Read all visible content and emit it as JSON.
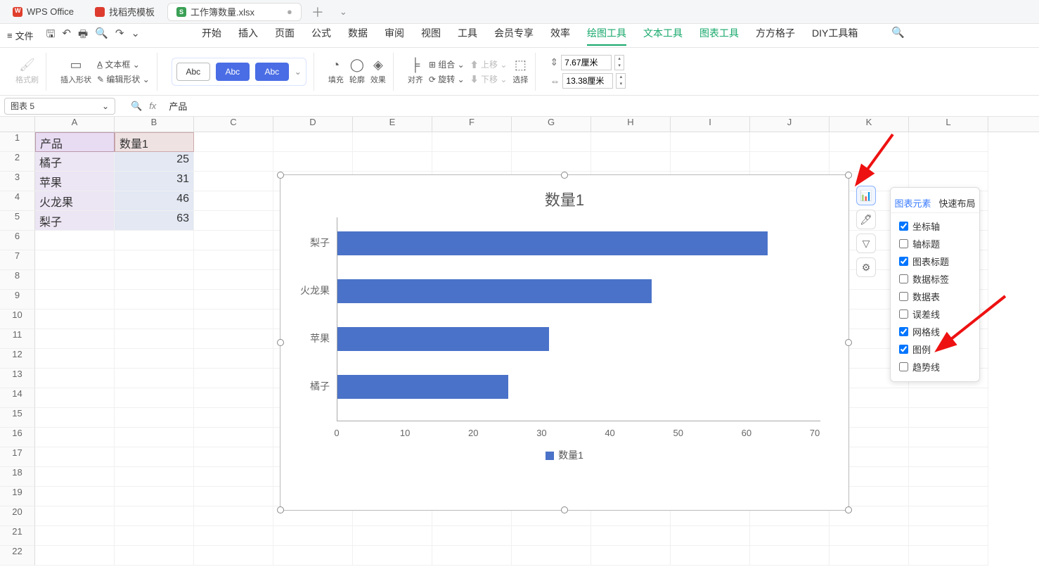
{
  "tabs": {
    "app": "WPS Office",
    "template": "找稻壳模板",
    "file": "工作簿数量.xlsx"
  },
  "menu": {
    "file": "文件",
    "items": [
      "开始",
      "插入",
      "页面",
      "公式",
      "数据",
      "审阅",
      "视图",
      "工具",
      "会员专享",
      "效率"
    ],
    "tools": [
      "绘图工具",
      "文本工具",
      "图表工具",
      "方方格子",
      "DIY工具箱"
    ]
  },
  "ribbon": {
    "fmt": "格式刷",
    "ins": "插入形状",
    "txt": "文本框",
    "edit": "编辑形状",
    "abc": "Abc",
    "fill": "填充",
    "outline": "轮廓",
    "effect": "效果",
    "align": "对齐",
    "group": "组合",
    "rotate": "旋转",
    "up": "上移",
    "down": "下移",
    "select": "选择",
    "h": "7.67厘米",
    "w": "13.38厘米"
  },
  "namebox": "图表 5",
  "fxval": "产品",
  "sheet": {
    "cols": [
      "A",
      "B",
      "C",
      "D",
      "E",
      "F",
      "G",
      "H",
      "I",
      "J",
      "K",
      "L"
    ],
    "headers": [
      "产品",
      "数量1"
    ],
    "rows": [
      {
        "p": "橘子",
        "v": "25"
      },
      {
        "p": "苹果",
        "v": "31"
      },
      {
        "p": "火龙果",
        "v": "46"
      },
      {
        "p": "梨子",
        "v": "63"
      }
    ]
  },
  "chart_data": {
    "type": "bar",
    "orientation": "horizontal",
    "title": "数量1",
    "categories": [
      "梨子",
      "火龙果",
      "苹果",
      "橘子"
    ],
    "values": [
      63,
      46,
      31,
      25
    ],
    "xlim": [
      0,
      70
    ],
    "xticks": [
      0,
      10,
      20,
      30,
      40,
      50,
      60,
      70
    ],
    "legend": "数量1",
    "series_color": "#4a72c8"
  },
  "popup": {
    "tab1": "图表元素",
    "tab2": "快速布局",
    "items": [
      {
        "label": "坐标轴",
        "checked": true
      },
      {
        "label": "轴标题",
        "checked": false
      },
      {
        "label": "图表标题",
        "checked": true
      },
      {
        "label": "数据标签",
        "checked": false
      },
      {
        "label": "数据表",
        "checked": false
      },
      {
        "label": "误差线",
        "checked": false
      },
      {
        "label": "网格线",
        "checked": true
      },
      {
        "label": "图例",
        "checked": true
      },
      {
        "label": "趋势线",
        "checked": false
      }
    ]
  }
}
